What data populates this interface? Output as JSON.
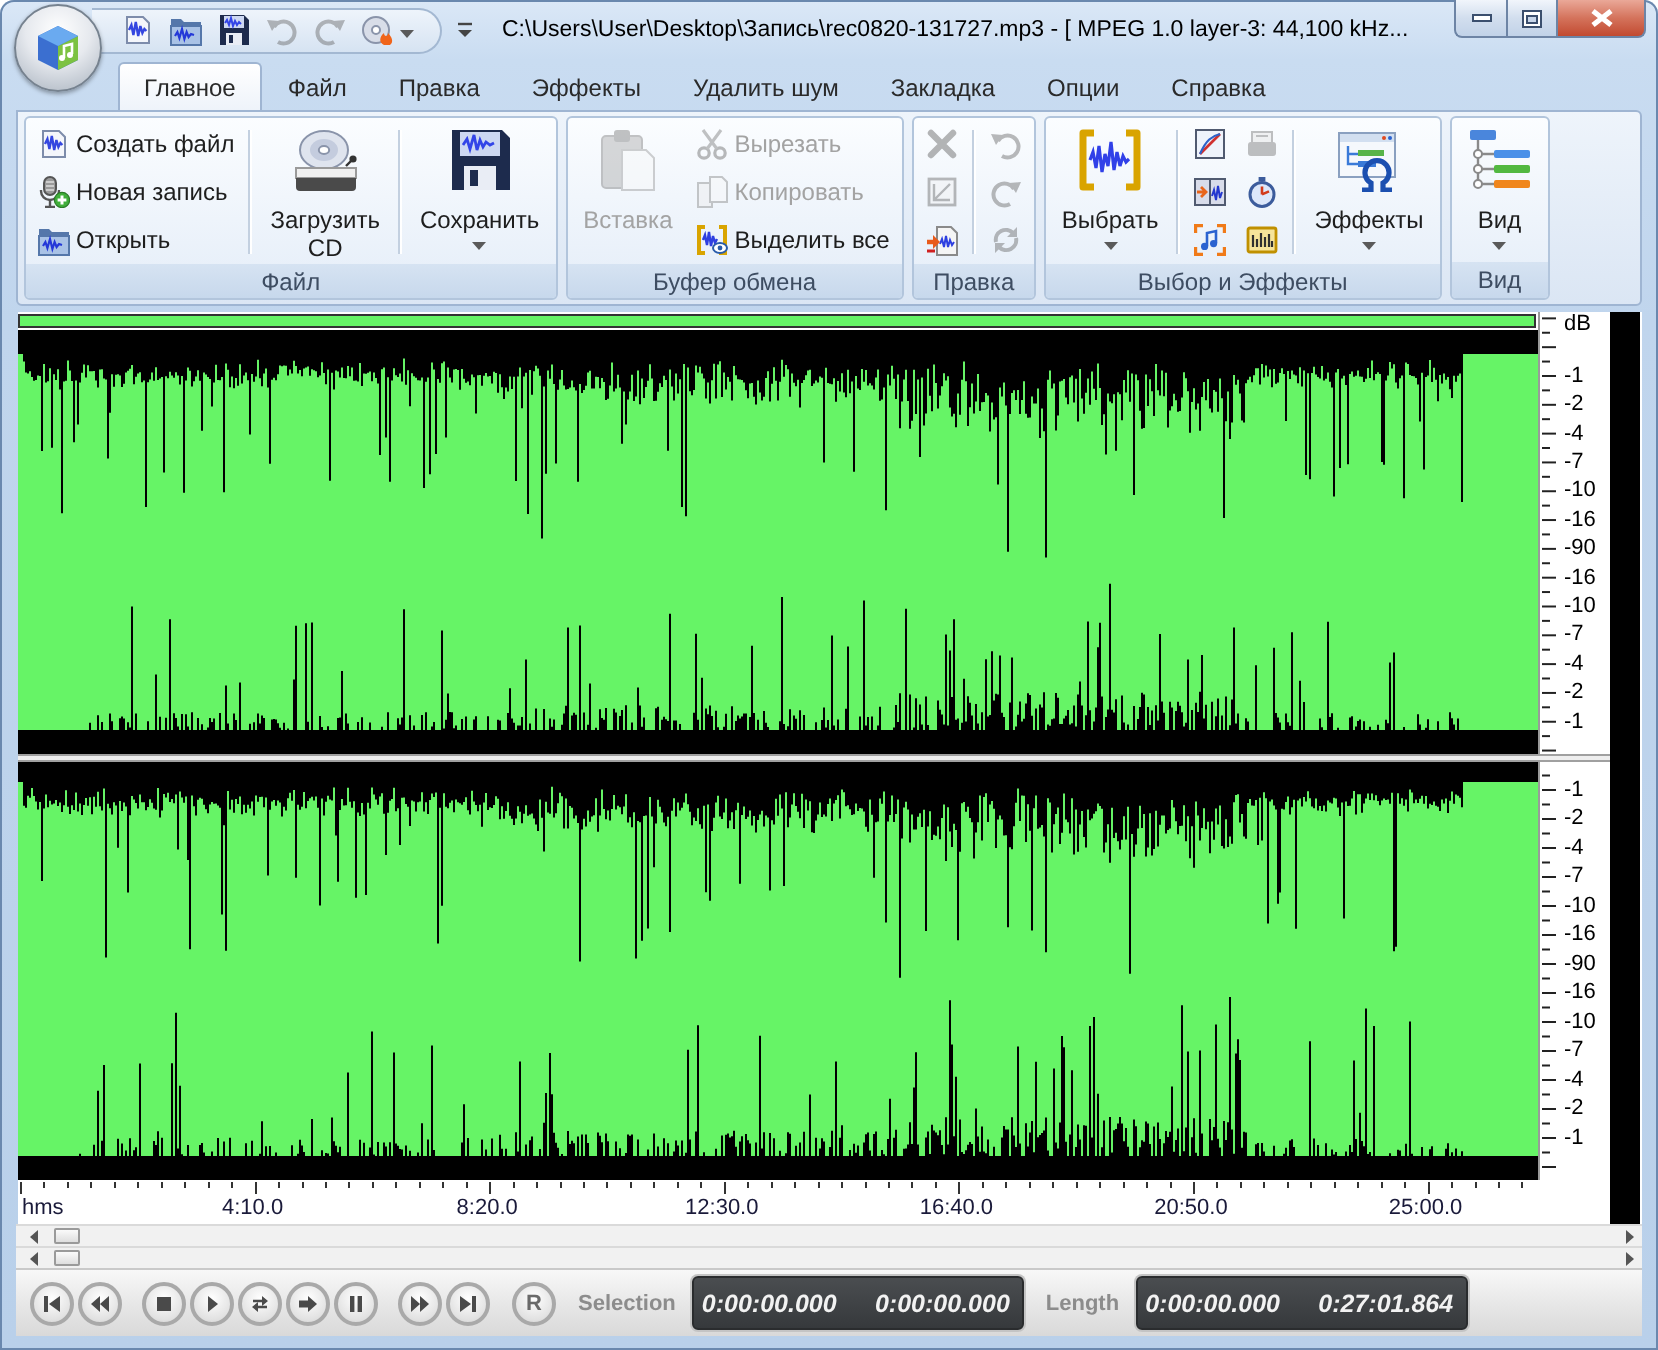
{
  "window": {
    "title": "C:\\Users\\User\\Desktop\\Запись\\rec0820-131727.mp3 - [ MPEG 1.0 layer-3: 44,100 kHz..."
  },
  "quick_access": [
    {
      "disabled": false,
      "dropdown": false
    },
    {
      "disabled": false,
      "dropdown": false
    },
    {
      "disabled": false,
      "dropdown": false
    },
    {
      "disabled": true,
      "dropdown": false
    },
    {
      "disabled": true,
      "dropdown": false
    },
    {
      "disabled": false,
      "dropdown": true
    }
  ],
  "tabs": [
    {
      "label": "Главное",
      "selected": true
    },
    {
      "label": "Файл",
      "selected": false
    },
    {
      "label": "Правка",
      "selected": false
    },
    {
      "label": "Эффекты",
      "selected": false
    },
    {
      "label": "Удалить шум",
      "selected": false
    },
    {
      "label": "Закладка",
      "selected": false
    },
    {
      "label": "Опции",
      "selected": false
    },
    {
      "label": "Справка",
      "selected": false
    }
  ],
  "ribbon": {
    "groups": [
      {
        "label": "Файл",
        "items": [
          {
            "kind": "stack",
            "buttons": [
              {
                "label": "Создать файл",
                "disabled": false
              },
              {
                "label": "Новая запись",
                "disabled": false
              },
              {
                "label": "Открыть",
                "disabled": false
              }
            ]
          },
          {
            "kind": "separator"
          },
          {
            "kind": "large",
            "label": "Загрузить CD",
            "disabled": false,
            "dropdown": false
          },
          {
            "kind": "separator"
          },
          {
            "kind": "large",
            "label": "Сохранить",
            "disabled": false,
            "dropdown": true
          }
        ]
      },
      {
        "label": "Буфер обмена",
        "items": [
          {
            "kind": "large",
            "label": "Вставка",
            "disabled": true,
            "dropdown": false
          },
          {
            "kind": "stack",
            "buttons": [
              {
                "label": "Вырезать",
                "disabled": true
              },
              {
                "label": "Копировать",
                "disabled": true
              },
              {
                "label": "Выделить все",
                "disabled": false
              }
            ]
          }
        ]
      },
      {
        "label": "Правка",
        "items": [
          {
            "kind": "icons",
            "buttons": [
              {
                "disabled": true
              },
              {
                "disabled": true
              },
              {
                "disabled": false
              }
            ]
          },
          {
            "kind": "separator"
          },
          {
            "kind": "icons",
            "buttons": [
              {
                "disabled": true
              },
              {
                "disabled": true
              },
              {
                "disabled": true
              }
            ]
          }
        ]
      },
      {
        "label": "Выбор и Эффекты",
        "items": [
          {
            "kind": "large",
            "label": "Выбрать",
            "disabled": false,
            "dropdown": true
          },
          {
            "kind": "separator"
          },
          {
            "kind": "icons",
            "buttons": [
              {
                "disabled": false
              },
              {
                "disabled": false
              },
              {
                "disabled": false
              }
            ]
          },
          {
            "kind": "icons",
            "buttons": [
              {
                "disabled": true
              },
              {
                "disabled": false
              },
              {
                "disabled": false
              }
            ]
          },
          {
            "kind": "separator"
          },
          {
            "kind": "large",
            "label": "Эффекты",
            "disabled": false,
            "dropdown": true
          }
        ]
      },
      {
        "label": "Вид",
        "items": [
          {
            "kind": "large",
            "label": "Вид",
            "disabled": false,
            "dropdown": true
          }
        ]
      }
    ]
  },
  "channels": [
    {
      "unit": "dB",
      "scale": [
        "-1",
        "-2",
        "-4",
        "-7",
        "-10",
        "-16",
        "-90",
        "-16",
        "-10",
        "-7",
        "-4",
        "-2",
        "-1"
      ]
    },
    {
      "scale": [
        "-1",
        "-2",
        "-4",
        "-7",
        "-10",
        "-16",
        "-90",
        "-16",
        "-10",
        "-7",
        "-4",
        "-2",
        "-1"
      ]
    }
  ],
  "timeline": {
    "unit": "hms",
    "labels": [
      "4:10.0",
      "8:20.0",
      "12:30.0",
      "16:40.0",
      "20:50.0",
      "25:00.0"
    ]
  },
  "transport": {
    "record_label": "R"
  },
  "selection": {
    "label": "Selection",
    "values": [
      "0:00:00.000",
      "0:00:00.000"
    ]
  },
  "length": {
    "label": "Length",
    "values": [
      "0:00:00.000",
      "0:27:01.864"
    ]
  }
}
